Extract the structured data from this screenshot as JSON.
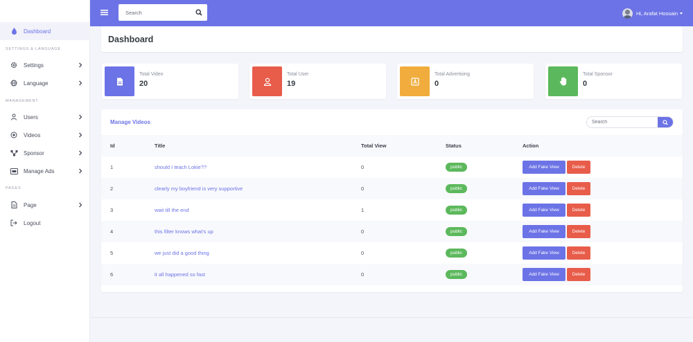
{
  "sidebar": {
    "items": [
      {
        "label": "Dashboard",
        "icon": "drop-icon"
      },
      {
        "label": "Settings",
        "icon": "gear-icon"
      },
      {
        "label": "Language",
        "icon": "globe-icon"
      },
      {
        "label": "Users",
        "icon": "user-icon"
      },
      {
        "label": "Videos",
        "icon": "play-circle-icon"
      },
      {
        "label": "Sponsor",
        "icon": "network-icon"
      },
      {
        "label": "Manage Ads",
        "icon": "ad-card-icon"
      },
      {
        "label": "Page",
        "icon": "file-icon"
      },
      {
        "label": "Logout",
        "icon": "logout-icon"
      }
    ],
    "sections": [
      "SETTINGS & LANGUAGE",
      "MANAGEMENT",
      "PAGES"
    ]
  },
  "topbar": {
    "search_placeholder": "Search",
    "user_greeting": "Hi, Arafat Hossain",
    "accent": "#6c73e6"
  },
  "header": {
    "title": "Dashboard"
  },
  "stats": [
    {
      "label": "Total Video",
      "value": "20",
      "color": "#6c73e6",
      "icon": "file-icon"
    },
    {
      "label": "Total User",
      "value": "19",
      "color": "#e85c4a",
      "icon": "user-icon"
    },
    {
      "label": "Total Advertising",
      "value": "0",
      "color": "#f0ad3d",
      "icon": "ad-icon"
    },
    {
      "label": "Total Sponsor",
      "value": "0",
      "color": "#5cb85c",
      "icon": "hand-icon"
    }
  ],
  "videos": {
    "title": "Manage Videos",
    "search_placeholder": "Search",
    "columns": [
      "Id",
      "Title",
      "Total View",
      "Status",
      "Action"
    ],
    "rows": [
      {
        "id": "1",
        "title": "should I teach Lokie??",
        "views": "0",
        "status": "public"
      },
      {
        "id": "2",
        "title": "clearly my boyfriend is very supportive",
        "views": "0",
        "status": "public"
      },
      {
        "id": "3",
        "title": "wait till the end",
        "views": "1",
        "status": "public"
      },
      {
        "id": "4",
        "title": "this filter knows what's up",
        "views": "0",
        "status": "public"
      },
      {
        "id": "5",
        "title": "we just did a good thing",
        "views": "0",
        "status": "public"
      },
      {
        "id": "6",
        "title": "it all happened so fast",
        "views": "0",
        "status": "public"
      }
    ],
    "fake_view_label": "Add Fake View",
    "delete_label": "Delete"
  }
}
